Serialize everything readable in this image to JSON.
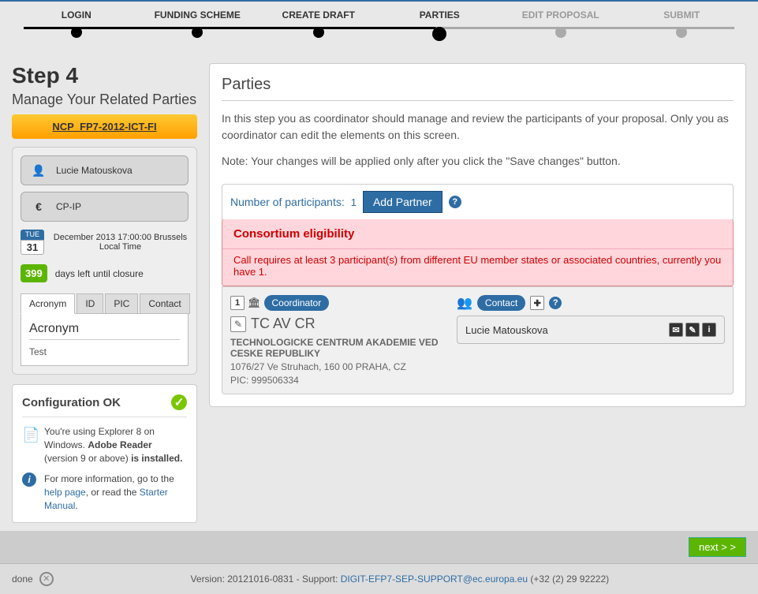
{
  "progress": {
    "steps": [
      "LOGIN",
      "FUNDING SCHEME",
      "CREATE DRAFT",
      "PARTIES",
      "EDIT PROPOSAL",
      "SUBMIT"
    ],
    "current_index": 3
  },
  "sidebar": {
    "step_title": "Step 4",
    "step_sub": "Manage Your Related Parties",
    "call_id": "NCP_FP7-2012-ICT-FI",
    "user": "Lucie Matouskova",
    "scheme": "CP-IP",
    "weekday": "TUE",
    "day": "31",
    "deadline": "December 2013 17:00:00 Brussels Local Time",
    "days_left": "399",
    "days_text": "days left until closure",
    "tabs": [
      "Acronym",
      "ID",
      "PIC",
      "Contact"
    ],
    "active_tab": "Acronym",
    "acronym_label": "Acronym",
    "acronym_value": "Test"
  },
  "config": {
    "heading": "Configuration OK",
    "browser_prefix": "You're using Explorer 8 on Windows. ",
    "adobe": "Adobe Reader",
    "browser_mid": " (version 9 or above) ",
    "installed_bold": "is installed.",
    "info_prefix": "For more information, go to the ",
    "help_link": "help page",
    "info_mid": ", or read the ",
    "manual_link": "Starter Manual",
    "period": "."
  },
  "main": {
    "title": "Parties",
    "p1": "In this step you as coordinator should manage and review the participants of your proposal. Only you as coordinator can edit the elements on this screen.",
    "p2": "Note: Your changes will be applied only after you click the \"Save changes\" button.",
    "nlabel": "Number of participants:",
    "ncount": "1",
    "add_btn": "Add Partner",
    "alert_title": "Consortium eligibility",
    "alert_body": "Call requires at least 3 participant(s) from different EU member states or associated countries, currently you have 1.",
    "party": {
      "num": "1",
      "role": "Coordinator",
      "acronym": "TC AV CR",
      "full": "TECHNOLOGICKE CENTRUM AKADEMIE VED CESKE REPUBLIKY",
      "addr": "1076/27 Ve Struhach, 160 00 PRAHA, CZ",
      "pic": "PIC: 999506334",
      "contact_label": "Contact",
      "contact_name": "Lucie Matouskova"
    }
  },
  "nextbtn": "next > >",
  "footer": {
    "done": "done",
    "version": "Version: 20121016-0831 - Support: ",
    "email": "DIGIT-EFP7-SEP-SUPPORT@ec.europa.eu",
    "phone": " (+32 (2) 29 92222)"
  }
}
